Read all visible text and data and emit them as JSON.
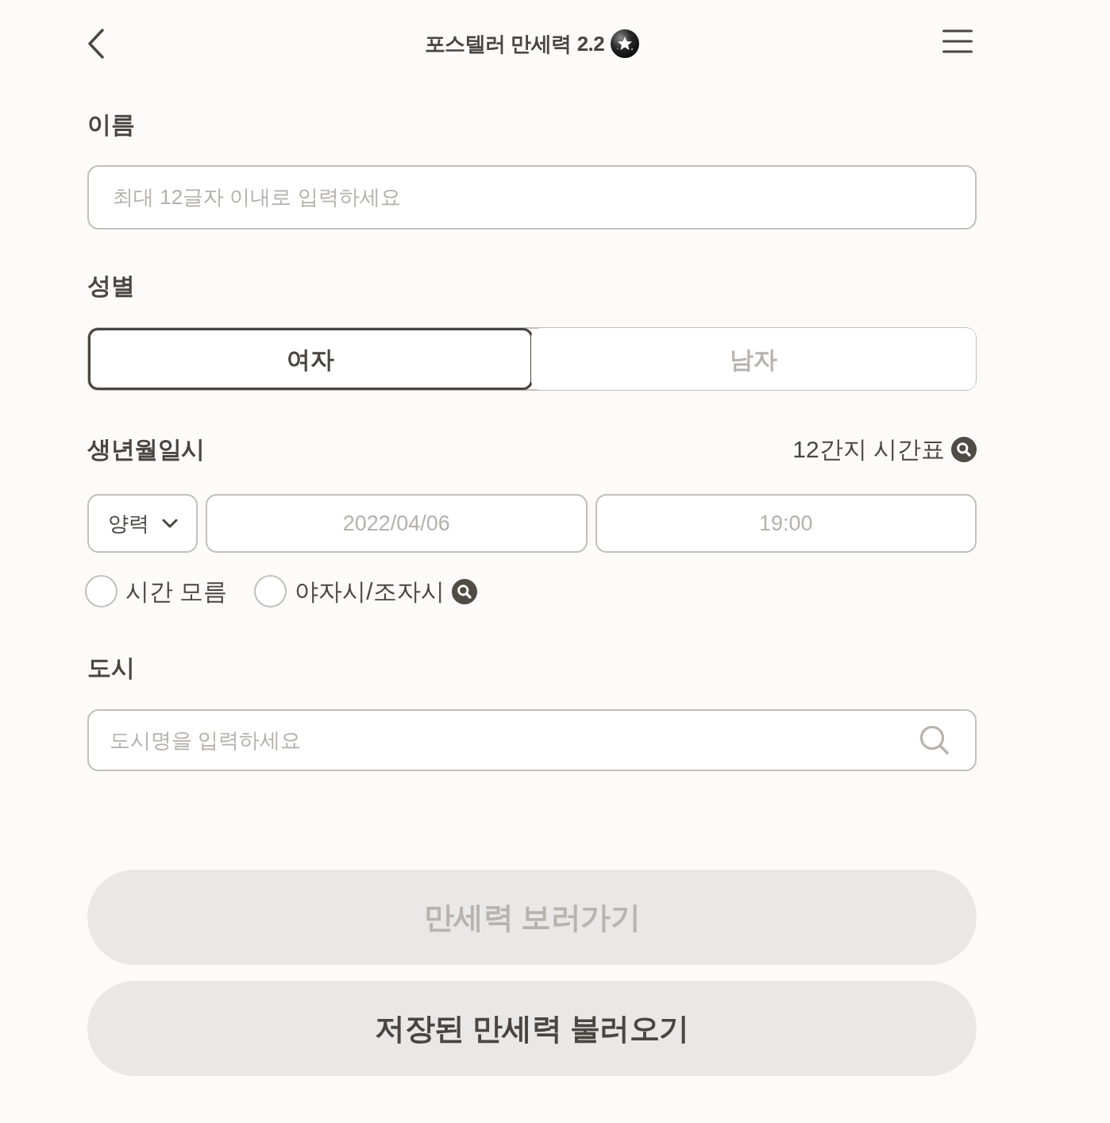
{
  "header": {
    "title": "포스텔러 만세력 2.2"
  },
  "name_field": {
    "label": "이름",
    "placeholder": "최대 12글자 이내로 입력하세요"
  },
  "gender": {
    "label": "성별",
    "options": [
      {
        "label": "여자",
        "selected": true
      },
      {
        "label": "남자",
        "selected": false
      }
    ]
  },
  "birth": {
    "label": "생년월일시",
    "table_link": "12간지 시간표",
    "calendar": "양력",
    "date": {
      "placeholder": "2022/04/06"
    },
    "time": {
      "placeholder": "19:00"
    },
    "options": [
      {
        "label": "시간 모름",
        "checked": false,
        "help_icon": false
      },
      {
        "label": "야자시/조자시",
        "checked": false,
        "help_icon": true
      }
    ]
  },
  "city_field": {
    "label": "도시",
    "placeholder": "도시명을 입력하세요"
  },
  "buttons": [
    {
      "label": "만세력 보러가기",
      "disabled": true
    },
    {
      "label": "저장된 만세력 불러오기",
      "disabled": false
    }
  ]
}
